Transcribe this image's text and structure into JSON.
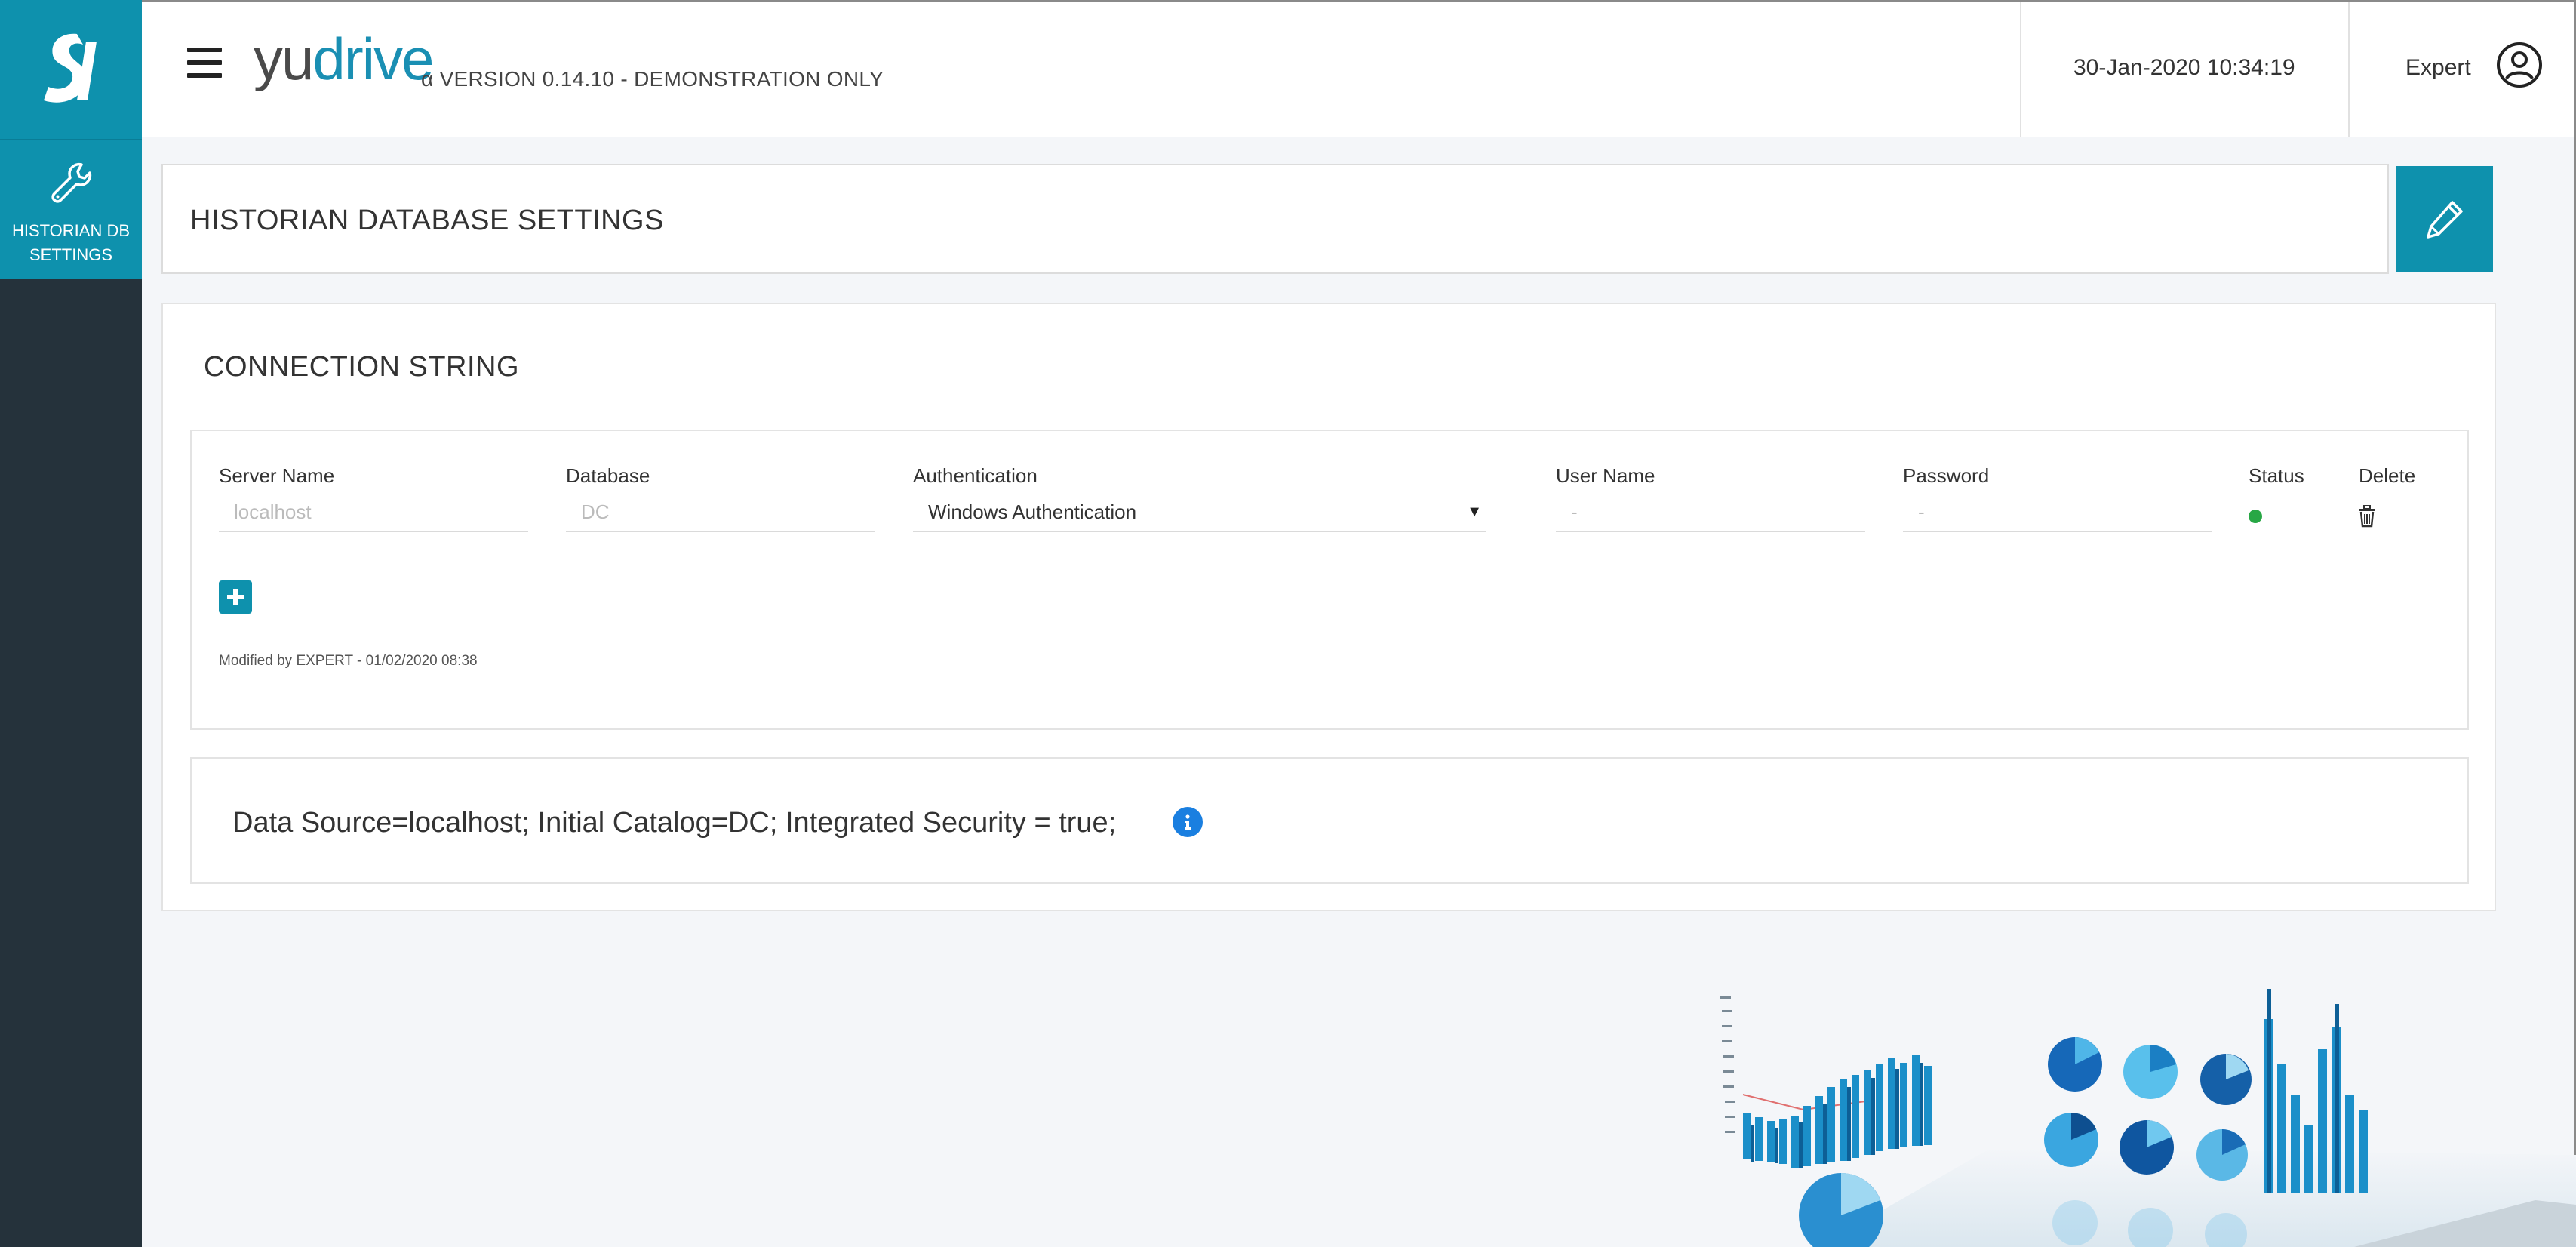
{
  "app": {
    "logo_text": "SV",
    "brand_yu": "yu",
    "brand_drive": "drive",
    "version": "α VERSION 0.14.10 - DEMONSTRATION ONLY",
    "datetime": "30-Jan-2020 10:34:19",
    "user": "Expert",
    "accent": "#0e91ad",
    "sidebar_bg": "#25323b"
  },
  "sidebar": {
    "items": [
      {
        "label": "HISTORIAN DB SETTINGS",
        "icon": "wrench-icon"
      }
    ]
  },
  "page": {
    "title": "HISTORIAN DATABASE SETTINGS",
    "edit_icon": "pencil-icon"
  },
  "connection": {
    "section_title": "CONNECTION STRING",
    "columns": {
      "server": "Server Name",
      "database": "Database",
      "auth": "Authentication",
      "user": "User Name",
      "password": "Password",
      "status": "Status",
      "delete": "Delete"
    },
    "row": {
      "server_placeholder": "localhost",
      "database_placeholder": "DC",
      "auth_value": "Windows Authentication",
      "user_placeholder": "-",
      "password_placeholder": "-",
      "status_color": "#28a745"
    },
    "modified": "Modified by EXPERT - 01/02/2020 08:38",
    "connection_string": "Data Source=localhost; Initial Catalog=DC; Integrated Security = true;"
  }
}
